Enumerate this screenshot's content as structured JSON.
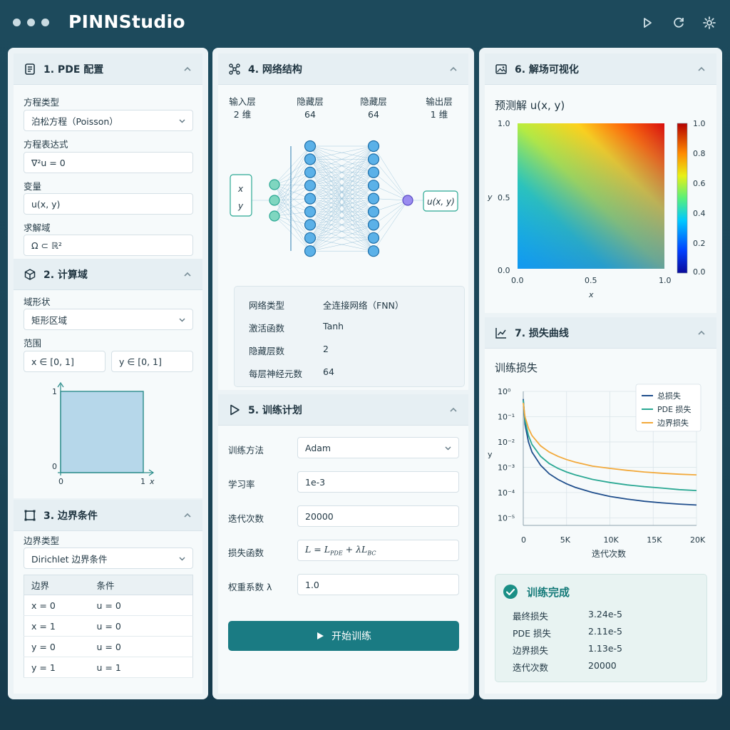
{
  "app": {
    "title": "PINNStudio"
  },
  "col1": {
    "pde": {
      "title": "1. PDE 配置",
      "eq_type_label": "方程类型",
      "eq_type_value": "泊松方程（Poisson）",
      "expr_label": "方程表达式",
      "expr_value": "∇²u = 0",
      "var_label": "变量",
      "var_value": "u(x, y)",
      "domain_label": "求解域",
      "domain_value": "Ω ⊂ ℝ²"
    },
    "domain": {
      "title": "2. 计算域",
      "shape_label": "域形状",
      "shape_value": "矩形区域",
      "range_label": "范围",
      "x_range": "x ∈ [0, 1]",
      "y_range": "y ∈ [0, 1]",
      "axis": {
        "y_top": "1",
        "y_bottom": "0",
        "x_left": "0",
        "x_right": "1",
        "x_name": "x"
      }
    },
    "bc": {
      "title": "3. 边界条件",
      "type_label": "边界类型",
      "type_value": "Dirichlet 边界条件",
      "headers": [
        "边界",
        "条件"
      ],
      "rows": [
        [
          "x = 0",
          "u = 0"
        ],
        [
          "x = 1",
          "u = 0"
        ],
        [
          "y = 0",
          "u = 0"
        ],
        [
          "y = 1",
          "u = 1"
        ]
      ]
    }
  },
  "col2": {
    "net": {
      "title": "4. 网络结构",
      "layers": [
        {
          "name": "输入层",
          "size": "2 维"
        },
        {
          "name": "隐藏层",
          "size": "64"
        },
        {
          "name": "隐藏层",
          "size": "64"
        },
        {
          "name": "输出层",
          "size": "1 维"
        }
      ],
      "inputs": [
        "x",
        "y"
      ],
      "output": "u(x, y)",
      "info": [
        {
          "k": "网络类型",
          "v": "全连接网络（FNN）"
        },
        {
          "k": "激活函数",
          "v": "Tanh"
        },
        {
          "k": "隐藏层数",
          "v": "2"
        },
        {
          "k": "每层神经元数",
          "v": "64"
        }
      ]
    },
    "train": {
      "title": "5. 训练计划",
      "method_label": "训练方法",
      "method_value": "Adam",
      "lr_label": "学习率",
      "lr_value": "1e-3",
      "iter_label": "迭代次数",
      "iter_value": "20000",
      "loss_label": "损失函数",
      "weight_label": "权重系数 λ",
      "weight_value": "1.0",
      "start_label": "开始训练"
    }
  },
  "col3": {
    "vis": {
      "title": "6. 解场可视化",
      "plot_title": "预测解 u(x, y)",
      "x_ticks": [
        "0.0",
        "0.5",
        "1.0"
      ],
      "y_ticks": [
        "1.0",
        "0.5",
        "0.0"
      ],
      "x_label": "x",
      "y_label": "y",
      "cbar_ticks": [
        "1.0",
        "0.8",
        "0.6",
        "0.4",
        "0.2",
        "0.0"
      ]
    },
    "loss": {
      "title": "7. 损失曲线",
      "done_title": "训练完成",
      "stats": [
        {
          "k": "最终损失",
          "v": "3.24e-5"
        },
        {
          "k": "PDE 损失",
          "v": "2.11e-5"
        },
        {
          "k": "边界损失",
          "v": "1.13e-5"
        },
        {
          "k": "迭代次数",
          "v": "20000"
        }
      ]
    }
  },
  "chart_data": {
    "type": "line",
    "title": "训练损失",
    "xlabel": "迭代次数",
    "ylabel": "y",
    "x_ticks": [
      "0",
      "5K",
      "10K",
      "15K",
      "20K"
    ],
    "y_ticks": [
      "10⁰",
      "10⁻¹",
      "10⁻²",
      "10⁻³",
      "10⁻⁴",
      "10⁻⁵"
    ],
    "xlim": [
      0,
      20000
    ],
    "ylim_log10": [
      -5.3,
      0
    ],
    "y_scale": "log",
    "grid": true,
    "legend": "top-right",
    "x": [
      0,
      200,
      600,
      1000,
      2000,
      3000,
      4000,
      5000,
      6000,
      8000,
      10000,
      12000,
      14000,
      16000,
      18000,
      20000
    ],
    "series": [
      {
        "name": "总损失",
        "color": "#1f4e8c",
        "values": [
          0.5,
          0.05,
          0.01,
          0.004,
          0.0012,
          0.00055,
          0.00033,
          0.00022,
          0.00016,
          0.0001,
          7e-05,
          5.5e-05,
          4.5e-05,
          3.9e-05,
          3.5e-05,
          3.2e-05
        ]
      },
      {
        "name": "PDE 损失",
        "color": "#2aa893",
        "values": [
          0.45,
          0.07,
          0.018,
          0.008,
          0.0027,
          0.0014,
          0.0009,
          0.00065,
          0.0005,
          0.00033,
          0.00025,
          0.0002,
          0.00017,
          0.00015,
          0.00013,
          0.00012
        ]
      },
      {
        "name": "边界损失",
        "color": "#f2a93b",
        "values": [
          0.35,
          0.1,
          0.035,
          0.018,
          0.007,
          0.004,
          0.0027,
          0.002,
          0.0016,
          0.0011,
          0.0009,
          0.00075,
          0.00065,
          0.00058,
          0.00053,
          0.0005
        ]
      }
    ]
  }
}
